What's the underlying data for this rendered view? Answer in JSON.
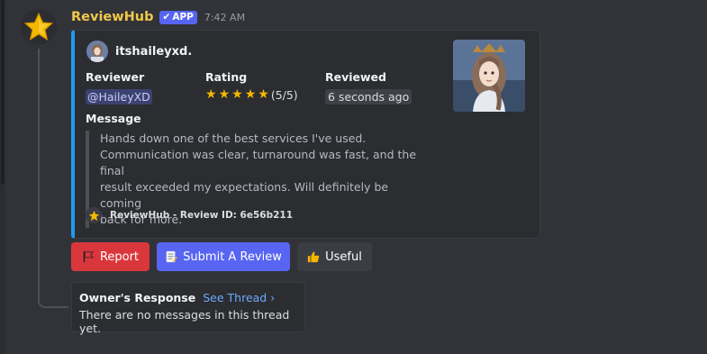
{
  "message": {
    "author": "ReviewHub",
    "badge": "APP",
    "timestamp": "7:42 AM"
  },
  "embed": {
    "accent_color": "#1e9af0",
    "author_name": "itshaileyxd.",
    "fields": {
      "reviewer_label": "Reviewer",
      "reviewer_value": "@HaileyXD",
      "rating_label": "Rating",
      "rating_stars": 5,
      "rating_value": "(5/5)",
      "reviewed_label": "Reviewed",
      "reviewed_value": "6 seconds ago"
    },
    "message_label": "Message",
    "message_lines": [
      "Hands down one of the best services I've used.",
      "Communication was clear, turnaround was fast, and the final",
      "result exceeded my expectations. Will definitely be coming",
      "back for more."
    ],
    "footer": "ReviewHub - Review ID: 6e56b211"
  },
  "buttons": {
    "report": "Report",
    "submit": "Submit A Review",
    "useful": "Useful"
  },
  "thread": {
    "title": "Owner's Response",
    "link": "See Thread ›",
    "empty": "There are no messages in this thread yet."
  },
  "colors": {
    "author": "#f0c84a",
    "report": "#da373c",
    "submit": "#5865f2",
    "star": "#f5b800"
  }
}
